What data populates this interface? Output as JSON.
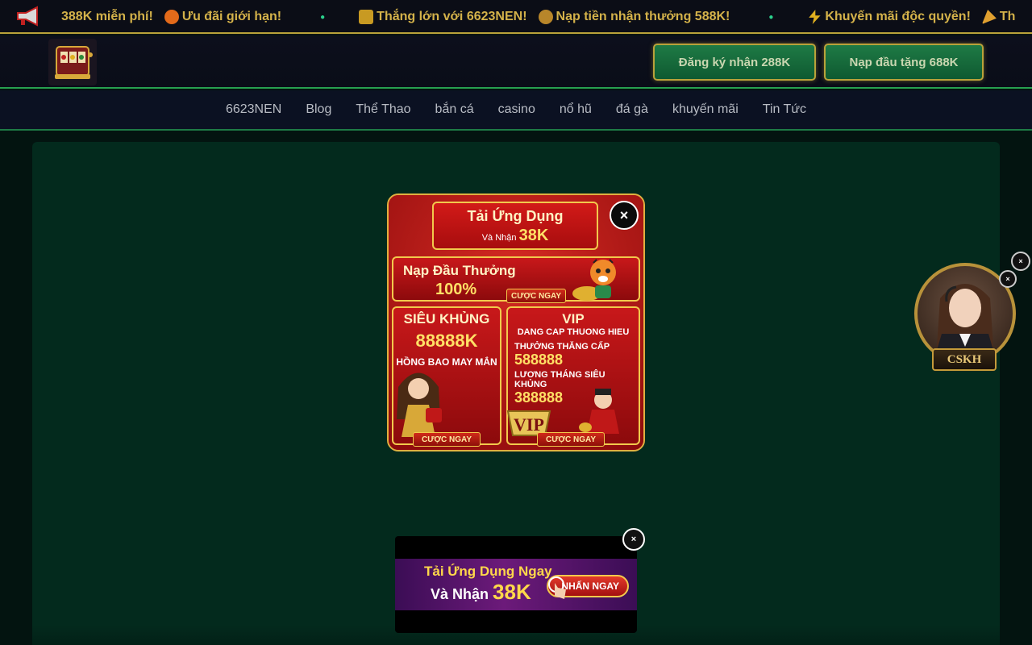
{
  "ticker": {
    "messages": [
      {
        "text": "388K miễn phí!",
        "icon": "fire-icon"
      },
      {
        "text": "Ưu đãi giới hạn!",
        "icon": "none"
      },
      {
        "text": "Thắng lớn với 6623NEN!",
        "icon": "trophy-icon"
      },
      {
        "text": "Nạp tiền nhận thưởng 588K!",
        "icon": "money-bag-icon"
      },
      {
        "text": "Khuyến mãi độc quyền!",
        "icon": "lightning-icon"
      },
      {
        "text": "Thar",
        "icon": "party-icon"
      }
    ]
  },
  "header": {
    "register_label": "Đăng ký nhận 288K",
    "deposit_label": "Nạp đầu tặng 688K"
  },
  "nav": {
    "items": [
      "6623NEN",
      "Blog",
      "Thể Thao",
      "bắn cá",
      "casino",
      "nổ hũ",
      "đá gà",
      "khuyến mãi",
      "Tin Tức"
    ]
  },
  "popup": {
    "banner_title": "Tải Ứng Dụng",
    "banner_sub": "Và Nhận",
    "banner_amount": "38K",
    "deposit_title": "Nạp Đầu Thưởng",
    "deposit_pct": "100%",
    "cta": "CƯỢC NGAY",
    "box2_title": "SIÊU KHỦNG",
    "box2_amount": "88888K",
    "box2_sub": "HỒNG BAO MAY MẮN",
    "box3_title": "VIP",
    "box3_sub": "DANG CAP THUONG HIEU",
    "box3_l1": "THƯỞNG THĂNG CẤP",
    "box3_v1": "588888",
    "box3_l2": "LƯƠNG THÁNG SIÊU KHỦNG",
    "box3_v2": "388888",
    "vip_badge": "VIP"
  },
  "ad": {
    "line1": "Tải Ứng Dụng Ngay",
    "line2": "Và Nhận",
    "amount": "38K",
    "button": "NHẤN NGAY"
  },
  "support": {
    "label": "CSKH"
  },
  "close_glyph": "×"
}
